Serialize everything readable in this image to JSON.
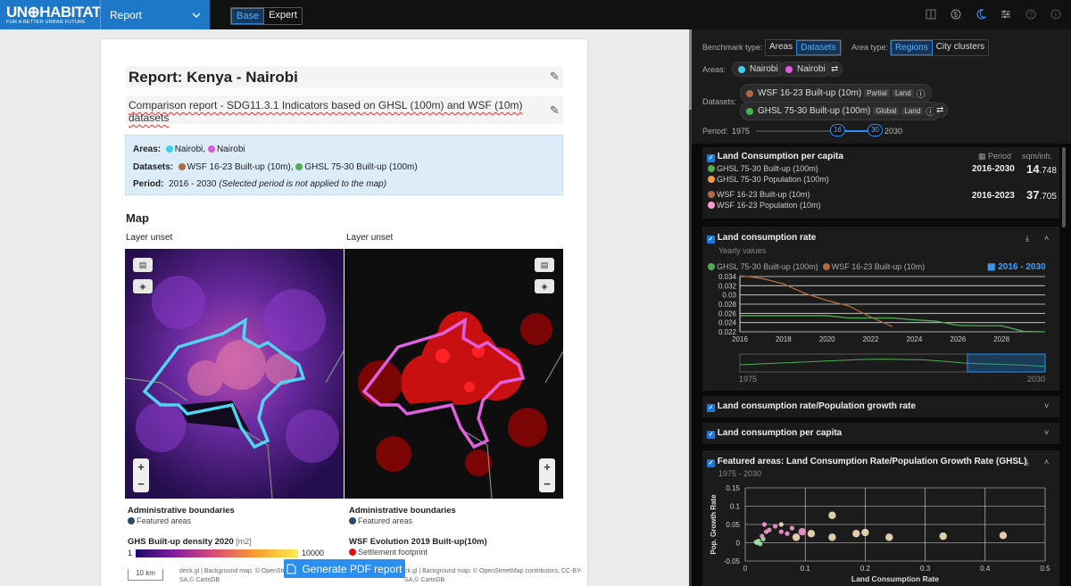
{
  "brand": {
    "logo_top": "UN⊕HABITAT",
    "logo_bottom": "FOR A BETTER URBAN FUTURE",
    "app": "Report"
  },
  "modes": {
    "base": "Base",
    "expert": "Expert"
  },
  "report": {
    "title": "Report: Kenya - Nairobi",
    "subtitle": "Comparison report - SDG11.3.1 Indicators based on GHSL (100m) and WSF (10m) datasets",
    "areas_label": "Areas:",
    "area1": "Nairobi",
    "area2": "Nairobi",
    "datasets_label": "Datasets:",
    "ds1": "WSF 16-23 Built-up (10m),",
    "ds2": "GHSL 75-30 Built-up (100m)",
    "period_label": "Period:",
    "period": "2016 - 2030",
    "period_note": "(Selected period is not applied to the map)",
    "map_heading": "Map",
    "layer_left": "Layer unset",
    "layer_right": "Layer unset",
    "admin_left": "Administrative boundaries",
    "featured_left": "Featured areas",
    "admin_right": "Administrative boundaries",
    "featured_right": "Featured areas",
    "ghs_title": "GHS Built-up density 2020",
    "ghs_unit": "[m2]",
    "ghs_min": "1",
    "ghs_max": "10000",
    "wsf_title": "WSF Evolution 2019 Built-up(10m)",
    "wsf_item": "Settlement footprint",
    "scale": "10 km",
    "attr_left": "deck.gl | Background map: © OpenStreetMap",
    "attr_left2": "SA,© CartoDB",
    "attr_right": "ck.gl | Background map: © OpenStreetMap contributors, CC-BY-",
    "attr_right2": "SA,© CartoDB",
    "gen_btn": "Generate PDF report"
  },
  "panel": {
    "bench_label": "Benchmark type:",
    "bench_areas": "Areas",
    "bench_datasets": "Datasets",
    "areatype_label": "Area type:",
    "at_regions": "Regions",
    "at_clusters": "City clusters",
    "areas_label": "Areas:",
    "area1": "Nairobi",
    "area2": "Nairobi",
    "datasets_label": "Datasets:",
    "ds1": "WSF 16-23 Built-up (10m)",
    "ds1_tag1": "Partial",
    "ds1_tag2": "Land",
    "ds2": "GHSL 75-30 Built-up (100m)",
    "ds2_tag1": "Global",
    "ds2_tag2": "Land",
    "period_label": "Period:",
    "period_start": "1975",
    "period_lo": "16",
    "period_hi": "30",
    "period_end": "2030"
  },
  "card1": {
    "title": "Land Consumption per capita",
    "period_hdr": "Period",
    "unit_hdr": "sqm/inh.",
    "r1a": "GHSL 75-30 Built-up (100m)",
    "r1b": "GHSL 75-30 Population (100m)",
    "r1_period": "2016-2030",
    "r1_int": "14",
    "r1_dec": ".748",
    "r2a": "WSF 16-23 Built-up (10m)",
    "r2b": "WSF 16-23 Population (10m)",
    "r2_period": "2016-2023",
    "r2_int": "37",
    "r2_dec": ".705"
  },
  "card2": {
    "title": "Land consumption rate",
    "subtitle": "Yearly values",
    "leg1": "GHSL 75-30 Built-up (100m)",
    "leg2": "WSF 16-23 Built-up (10m)",
    "period": "2016 - 2030",
    "brush_start": "1975",
    "brush_end": "2030"
  },
  "card3": {
    "title": "Land consumption rate/Population growth rate"
  },
  "card4": {
    "title": "Land consumption per capita"
  },
  "card5": {
    "title": "Featured areas: Land Consumption Rate/Population Growth Rate (GHSL)",
    "subtitle": "1975 - 2030"
  },
  "colors": {
    "cyan": "#3ad0f0",
    "magenta": "#e058e0",
    "brown": "#b06a42",
    "green": "#4caf50",
    "orange": "#f39b3a",
    "pink": "#f59bd0",
    "accent": "#1e78c8"
  },
  "chart_data": [
    {
      "type": "line",
      "x": [
        2016,
        2017,
        2018,
        2019,
        2020,
        2021,
        2022,
        2023,
        2024,
        2025,
        2026,
        2027,
        2028,
        2029,
        2030
      ],
      "series": [
        {
          "name": "GHSL 75-30 Built-up (100m)",
          "values": [
            0.0255,
            0.0255,
            0.0255,
            0.0255,
            0.0255,
            0.025,
            0.025,
            0.025,
            0.0246,
            0.0243,
            0.0234,
            0.0233,
            0.0233,
            0.0221,
            0.0218
          ]
        },
        {
          "name": "WSF 16-23 Built-up (10m)",
          "values": [
            0.0342,
            0.0336,
            0.0324,
            0.0303,
            0.0288,
            0.0276,
            0.0252,
            0.0231
          ]
        }
      ],
      "xticks": [
        2016,
        2018,
        2020,
        2022,
        2024,
        2026,
        2028
      ],
      "yticks": [
        0.022,
        0.024,
        0.026,
        0.028,
        0.03,
        0.032,
        0.034
      ],
      "ylim": [
        0.022,
        0.034
      ],
      "xlim": [
        2016,
        2030
      ],
      "grid": true
    },
    {
      "type": "scatter",
      "xlabel": "Land Consumption Rate",
      "ylabel": "Pop. Growth Rate",
      "xticks": [
        0,
        0.1,
        0.2,
        0.3,
        0.4,
        0.5
      ],
      "yticks": [
        -0.05,
        0,
        0.05,
        0.1,
        0.15
      ],
      "xlim": [
        0,
        0.5
      ],
      "ylim": [
        -0.05,
        0.15
      ],
      "points": [
        [
          0.02,
          0.0,
          "#9de0a0"
        ],
        [
          0.022,
          0.005,
          "#9de0a0"
        ],
        [
          0.025,
          -0.003,
          "#9de0a0"
        ],
        [
          0.018,
          0.002,
          "#9de0a0"
        ],
        [
          0.03,
          0.01,
          "#9de0a0"
        ],
        [
          0.028,
          0.018,
          "#f59bd0"
        ],
        [
          0.035,
          0.03,
          "#f59bd0"
        ],
        [
          0.04,
          0.035,
          "#f59bd0"
        ],
        [
          0.05,
          0.045,
          "#f59bd0"
        ],
        [
          0.032,
          0.05,
          "#f59bd0"
        ],
        [
          0.06,
          0.03,
          "#f59bd0"
        ],
        [
          0.07,
          0.025,
          "#f59bd0"
        ],
        [
          0.085,
          0.015,
          "#f5e0b8"
        ],
        [
          0.095,
          0.03,
          "#f59bd0"
        ],
        [
          0.11,
          0.025,
          "#f5e0b8"
        ],
        [
          0.145,
          0.075,
          "#f5e0b8"
        ],
        [
          0.145,
          0.015,
          "#f5e0b8"
        ],
        [
          0.185,
          0.025,
          "#f5e0b8"
        ],
        [
          0.2,
          0.028,
          "#f5e0b8"
        ],
        [
          0.24,
          0.015,
          "#f5e0b8"
        ],
        [
          0.33,
          0.018,
          "#f5e0b8"
        ],
        [
          0.43,
          0.02,
          "#f5e0b8"
        ],
        [
          0.06,
          0.05,
          "#f5e0b8"
        ],
        [
          0.078,
          0.04,
          "#f59bd0"
        ]
      ]
    }
  ]
}
